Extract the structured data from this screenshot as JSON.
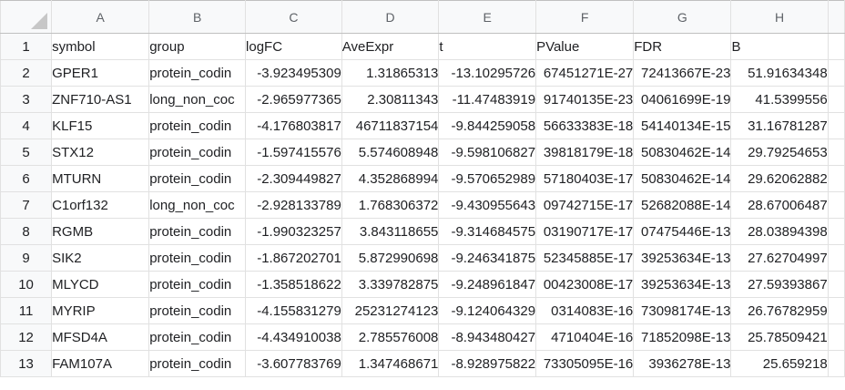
{
  "columns": [
    "A",
    "B",
    "C",
    "D",
    "E",
    "F",
    "G",
    "H"
  ],
  "rows": [
    {
      "num": "1",
      "cells": [
        "symbol",
        "group",
        "logFC",
        "AveExpr",
        "t",
        "PValue",
        "FDR",
        "B"
      ]
    },
    {
      "num": "2",
      "cells": [
        "GPER1",
        "protein_codin",
        "-3.923495309",
        "1.31865313",
        "-13.10295726",
        "67451271E-27",
        "72413667E-23",
        "51.91634348"
      ]
    },
    {
      "num": "3",
      "cells": [
        "ZNF710-AS1",
        "long_non_coc",
        "-2.965977365",
        "2.30811343",
        "-11.47483919",
        "91740135E-23",
        "04061699E-19",
        "41.5399556"
      ]
    },
    {
      "num": "4",
      "cells": [
        "KLF15",
        "protein_codin",
        "-4.176803817",
        "46711837154",
        "-9.844259058",
        "56633383E-18",
        "54140134E-15",
        "31.16781287"
      ]
    },
    {
      "num": "5",
      "cells": [
        "STX12",
        "protein_codin",
        "-1.597415576",
        "5.574608948",
        "-9.598106827",
        "39818179E-18",
        "50830462E-14",
        "29.79254653"
      ]
    },
    {
      "num": "6",
      "cells": [
        "MTURN",
        "protein_codin",
        "-2.309449827",
        "4.352868994",
        "-9.570652989",
        "57180403E-17",
        "50830462E-14",
        "29.62062882"
      ]
    },
    {
      "num": "7",
      "cells": [
        "C1orf132",
        "long_non_coc",
        "-2.928133789",
        "1.768306372",
        "-9.430955643",
        "09742715E-17",
        "52682088E-14",
        "28.67006487"
      ]
    },
    {
      "num": "8",
      "cells": [
        "RGMB",
        "protein_codin",
        "-1.990323257",
        "3.843118655",
        "-9.314684575",
        "03190717E-17",
        "07475446E-13",
        "28.03894398"
      ]
    },
    {
      "num": "9",
      "cells": [
        "SIK2",
        "protein_codin",
        "-1.867202701",
        "5.872990698",
        "-9.246341875",
        "52345885E-17",
        "39253634E-13",
        "27.62704997"
      ]
    },
    {
      "num": "10",
      "cells": [
        "MLYCD",
        "protein_codin",
        "-1.358518622",
        "3.339782875",
        "-9.248961847",
        "00423008E-17",
        "39253634E-13",
        "27.59393867"
      ]
    },
    {
      "num": "11",
      "cells": [
        "MYRIP",
        "protein_codin",
        "-4.155831279",
        "25231274123",
        "-9.124064329",
        "0314083E-16",
        "73098174E-13",
        "26.76782959"
      ]
    },
    {
      "num": "12",
      "cells": [
        "MFSD4A",
        "protein_codin",
        "-4.434910038",
        "2.785576008",
        "-8.943480427",
        "4710404E-16",
        "71852098E-13",
        "25.78509421"
      ]
    },
    {
      "num": "13",
      "cells": [
        "FAM107A",
        "protein_codin",
        "-3.607783769",
        "1.347468671",
        "-8.928975822",
        "73305095E-16",
        "3936278E-13",
        "25.659218"
      ]
    }
  ]
}
